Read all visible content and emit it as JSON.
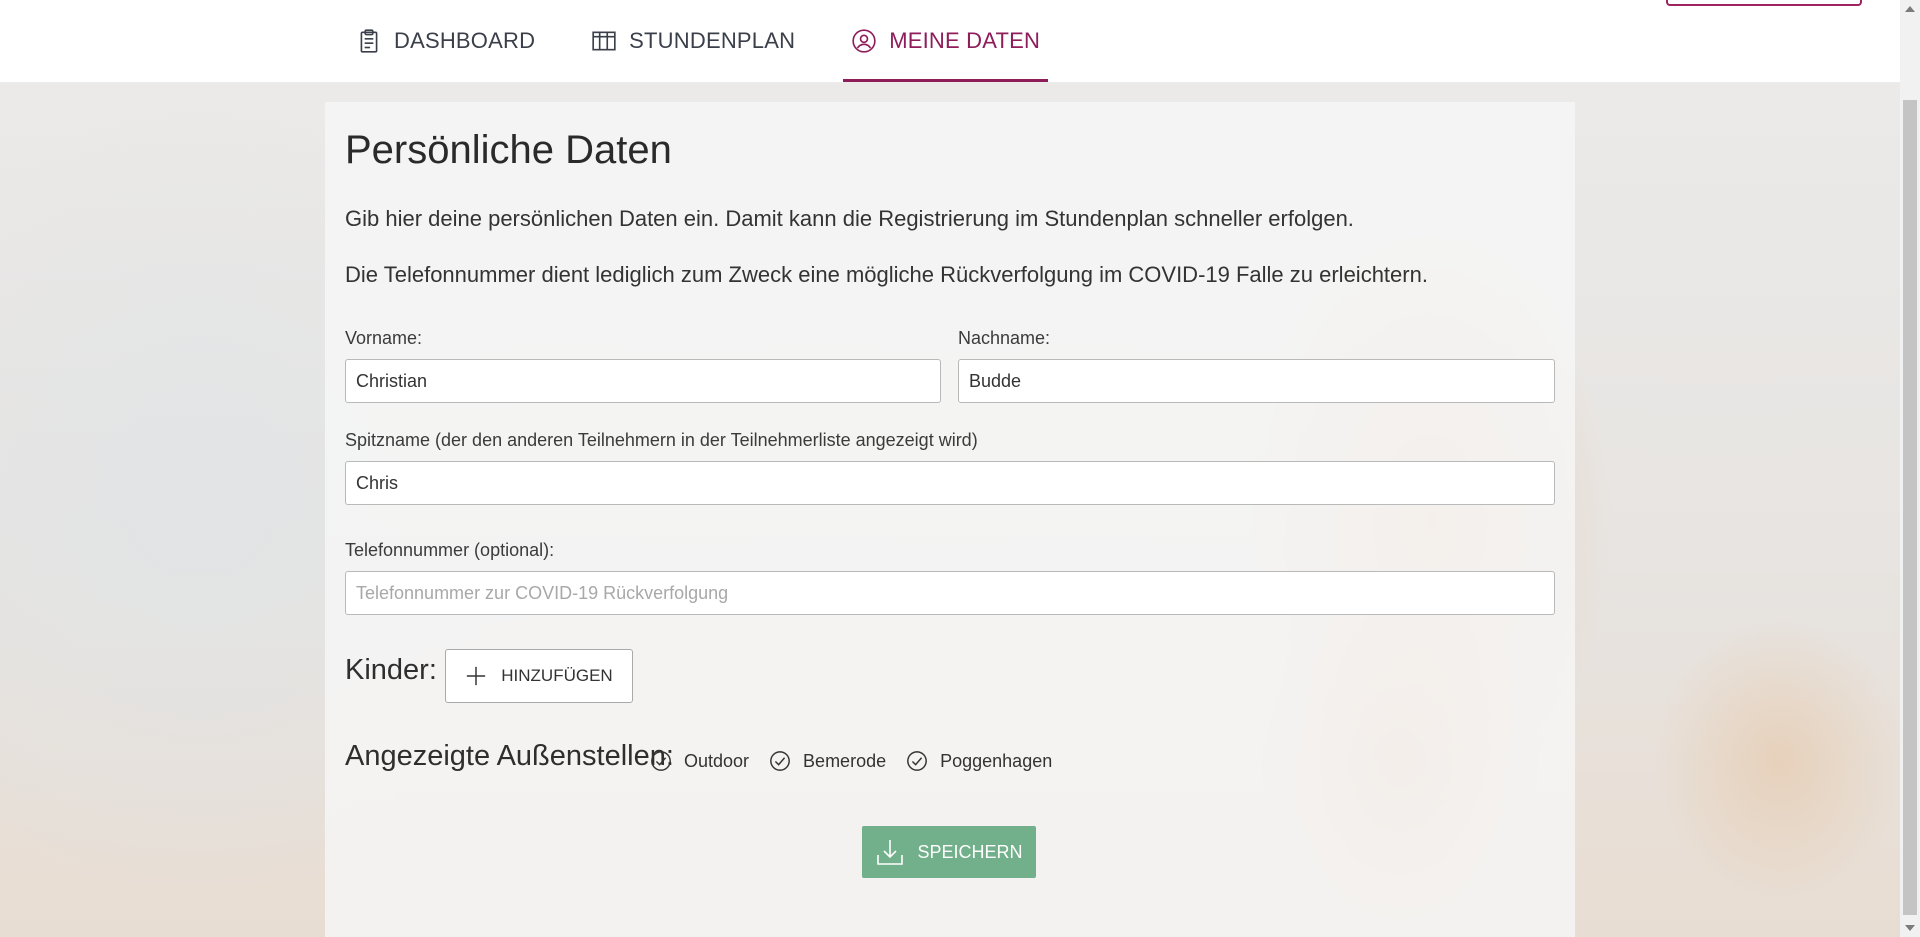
{
  "nav": {
    "items": [
      {
        "label": "DASHBOARD",
        "icon": "clipboard-icon",
        "active": false
      },
      {
        "label": "STUNDENPLAN",
        "icon": "table-grid-icon",
        "active": false
      },
      {
        "label": "MEINE DATEN",
        "icon": "user-circle-icon",
        "active": true
      }
    ]
  },
  "colors": {
    "accent": "#8e1d5a",
    "save": "#71b08a"
  },
  "page": {
    "title": "Persönliche Daten",
    "intro1": "Gib hier deine persönlichen Daten ein. Damit kann die Registrierung im Stundenplan schneller erfolgen.",
    "intro2": "Die Telefonnummer dient lediglich zum Zweck eine mögliche Rückverfolgung im COVID-19 Falle zu erleichtern."
  },
  "form": {
    "vorname": {
      "label": "Vorname:",
      "value": "Christian"
    },
    "nachname": {
      "label": "Nachname:",
      "value": "Budde"
    },
    "spitzname": {
      "label": "Spitzname (der den anderen Teilnehmern in der Teilnehmerliste angezeigt wird)",
      "value": "Chris"
    },
    "telefon": {
      "label": "Telefonnummer (optional):",
      "value": "",
      "placeholder": "Telefonnummer zur COVID-19 Rückverfolgung"
    }
  },
  "kinder": {
    "label": "Kinder:",
    "add_label": "HINZUFÜGEN"
  },
  "aussenstellen": {
    "label": "Angezeigte Außenstellen:",
    "options": [
      {
        "label": "Outdoor",
        "checked": true
      },
      {
        "label": "Bemerode",
        "checked": true
      },
      {
        "label": "Poggenhagen",
        "checked": true
      }
    ]
  },
  "save_label": "SPEICHERN"
}
